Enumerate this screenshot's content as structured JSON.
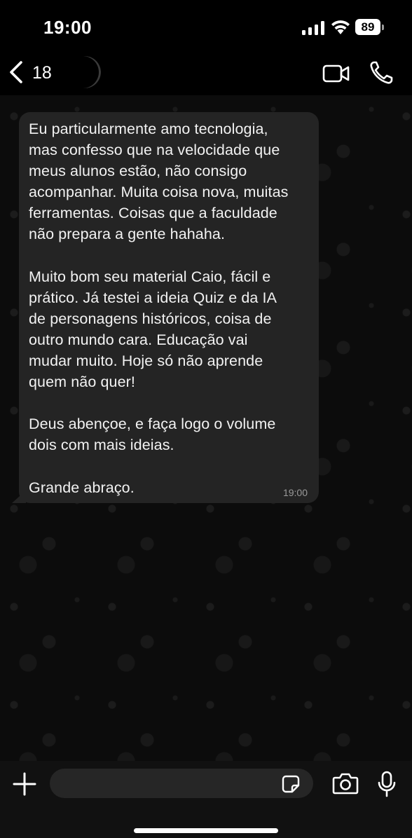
{
  "status_bar": {
    "time": "19:00",
    "battery": "89",
    "icons": [
      "signal-icon",
      "wifi-icon",
      "battery-icon"
    ]
  },
  "header": {
    "back_count": "18",
    "icons": [
      "back-chevron-icon",
      "avatar",
      "video-call-icon",
      "phone-call-icon"
    ]
  },
  "message": {
    "text": "Eu particularmente amo tecnologia,\nmas confesso que na velocidade que\nmeus alunos estão, não consigo\nacompanhar. Muita coisa nova, muitas\nferramentas. Coisas que a faculdade\nnão prepara a gente hahaha.\n\nMuito bom seu material Caio, fácil e\nprático. Já testei a ideia Quiz e da IA\nde personagens históricos, coisa de\noutro mundo cara. Educação vai\nmudar muito. Hoje só não aprende\nquem não quer!\n\nDeus abençoe, e faça logo o volume\ndois com mais ideias.\n\nGrande abraço.",
    "time": "19:00"
  },
  "composer": {
    "placeholder": "",
    "icons": [
      "plus-icon",
      "sticker-icon",
      "camera-icon",
      "microphone-icon"
    ]
  },
  "colors": {
    "background": "#0c0c0c",
    "bubble": "#242424",
    "bar": "#000000"
  }
}
